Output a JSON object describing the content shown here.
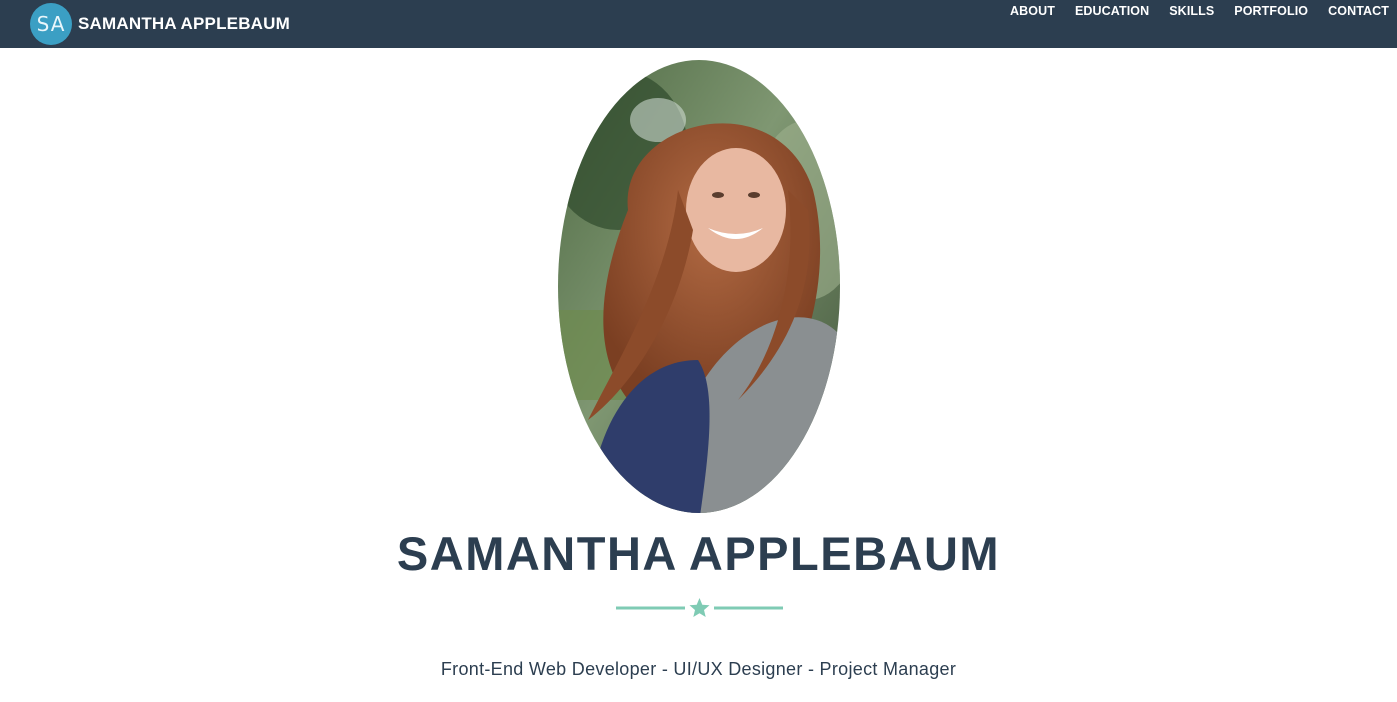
{
  "navbar": {
    "logo_initials": "SA",
    "brand_name": "SAMANTHA APPLEBAUM",
    "links": [
      "ABOUT",
      "EDUCATION",
      "SKILLS",
      "PORTFOLIO",
      "CONTACT"
    ]
  },
  "hero": {
    "name": "SAMANTHA APPLEBAUM",
    "divider_icon": "star-icon",
    "tagline": "Front-End Web Developer - UI/UX Designer - Project Manager"
  },
  "colors": {
    "navbar_bg": "#2c3e50",
    "logo_bg": "#3b9fc4",
    "accent": "#7fcbb4",
    "text_dark": "#2c3e50"
  }
}
